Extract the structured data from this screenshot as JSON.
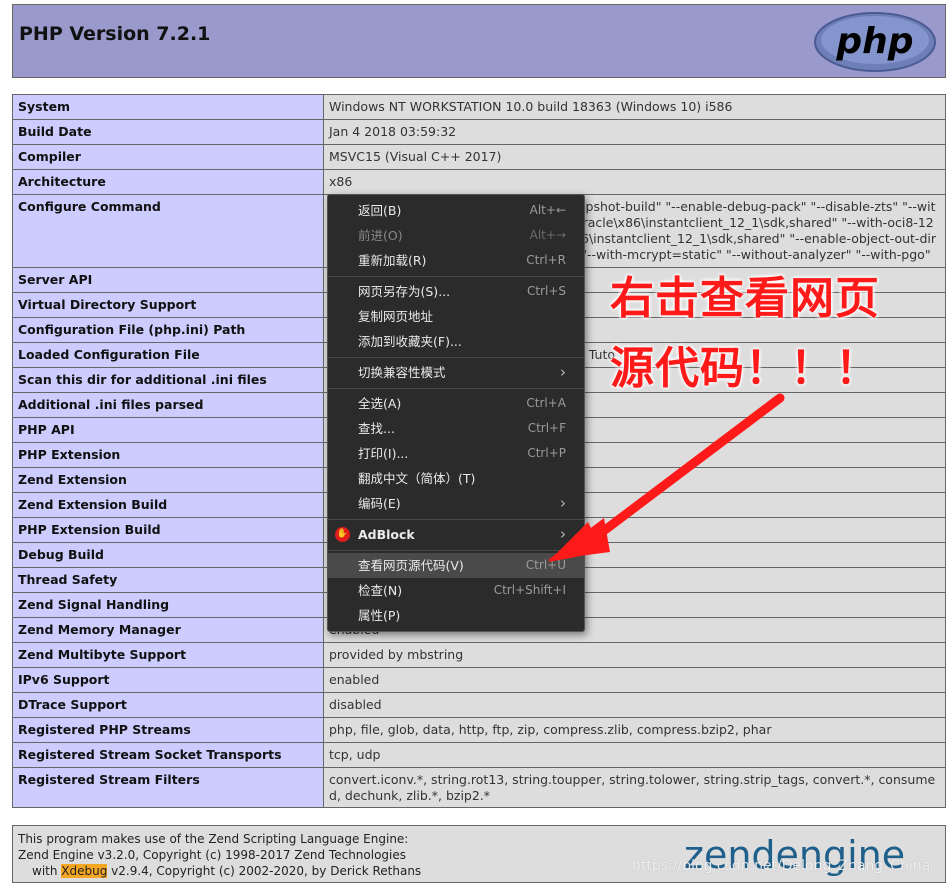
{
  "header": {
    "title": "PHP Version 7.2.1",
    "logo_text": "php"
  },
  "rows": [
    {
      "key": "System",
      "value": "Windows NT WORKSTATION 10.0 build 18363 (Windows 10) i586"
    },
    {
      "key": "Build Date",
      "value": "Jan 4 2018 03:59:32"
    },
    {
      "key": "Compiler",
      "value": "MSVC15 (Visual C++ 2017)"
    },
    {
      "key": "Architecture",
      "value": "x86"
    },
    {
      "key": "Configure Command",
      "value": "cscript /nologo configure.js \"--enable-snapshot-build\" \"--enable-debug-pack\" \"--disable-zts\" \"--with-pdo-oci=c:\\php-snap-build\\deps_aux\\oracle\\x86\\instantclient_12_1\\sdk,shared\" \"--with-oci8-12c=c:\\php-snap-build\\deps_aux\\oracle\\x86\\instantclient_12_1\\sdk,shared\" \"--enable-object-out-dir=../obj/\" \"--enable-com-dotnet=shared\" \"--with-mcrypt=static\" \"--without-analyzer\" \"--with-pgo\""
    },
    {
      "key": "Server API",
      "value": ""
    },
    {
      "key": "Virtual Directory Support",
      "value": ""
    },
    {
      "key": "Configuration File (php.ini) Path",
      "value": ""
    },
    {
      "key": "Loaded Configuration File",
      "value": "Tuto"
    },
    {
      "key": "Scan this dir for additional .ini files",
      "value": ""
    },
    {
      "key": "Additional .ini files parsed",
      "value": ""
    },
    {
      "key": "PHP API",
      "value": ""
    },
    {
      "key": "PHP Extension",
      "value": ""
    },
    {
      "key": "Zend Extension",
      "value": ""
    },
    {
      "key": "Zend Extension Build",
      "value": ""
    },
    {
      "key": "PHP Extension Build",
      "value": ""
    },
    {
      "key": "Debug Build",
      "value": ""
    },
    {
      "key": "Thread Safety",
      "value": ""
    },
    {
      "key": "Zend Signal Handling",
      "value": ""
    },
    {
      "key": "Zend Memory Manager",
      "value": "enabled"
    },
    {
      "key": "Zend Multibyte Support",
      "value": "provided by mbstring"
    },
    {
      "key": "IPv6 Support",
      "value": "enabled"
    },
    {
      "key": "DTrace Support",
      "value": "disabled"
    },
    {
      "key": "Registered PHP Streams",
      "value": "php, file, glob, data, http, ftp, zip, compress.zlib, compress.bzip2, phar"
    },
    {
      "key": "Registered Stream Socket Transports",
      "value": "tcp, udp"
    },
    {
      "key": "Registered Stream Filters",
      "value": "convert.iconv.*, string.rot13, string.toupper, string.tolower, string.strip_tags, convert.*, consumed, dechunk, zlib.*, bzip2.*"
    }
  ],
  "footer": {
    "line1": "This program makes use of the Zend Scripting Language Engine:",
    "line2": "Zend Engine v3.2.0, Copyright (c) 1998-2017 Zend Technologies",
    "line3_prefix": "with ",
    "line3_highlight": "Xdebug",
    "line3_suffix": " v2.9.4, Copyright (c) 2002-2020, by Derick Rethans",
    "logo_text": "zendengine"
  },
  "watermark": "https://blog.csdn.net/Delong_Zhang_China",
  "context_menu": {
    "items": [
      {
        "label": "返回(B)",
        "shortcut": "Alt+←"
      },
      {
        "label": "前进(O)",
        "shortcut": "Alt+→"
      },
      {
        "label": "重新加载(R)",
        "shortcut": "Ctrl+R"
      },
      {
        "label": "网页另存为(S)...",
        "shortcut": "Ctrl+S"
      },
      {
        "label": "复制网页地址",
        "shortcut": ""
      },
      {
        "label": "添加到收藏夹(F)...",
        "shortcut": ""
      },
      {
        "label": "切换兼容性模式",
        "shortcut": ""
      },
      {
        "label": "全选(A)",
        "shortcut": "Ctrl+A"
      },
      {
        "label": "查找...",
        "shortcut": "Ctrl+F"
      },
      {
        "label": "打印(I)...",
        "shortcut": "Ctrl+P"
      },
      {
        "label": "翻成中文（简体）(T)",
        "shortcut": ""
      },
      {
        "label": "编码(E)",
        "shortcut": ""
      },
      {
        "label": "AdBlock",
        "shortcut": ""
      },
      {
        "label": "查看网页源代码(V)",
        "shortcut": "Ctrl+U"
      },
      {
        "label": "检查(N)",
        "shortcut": "Ctrl+Shift+I"
      },
      {
        "label": "属性(P)",
        "shortcut": ""
      }
    ]
  },
  "annotation": {
    "line1": "右击查看网页",
    "line2": "源代码！！！"
  },
  "colors": {
    "header_bg": "#9999cc",
    "key_bg": "#ccccff",
    "value_bg": "#dddddd",
    "menu_bg": "#2b2b2b",
    "annotation": "#ff1a1a",
    "highlight": "#f5a623"
  }
}
